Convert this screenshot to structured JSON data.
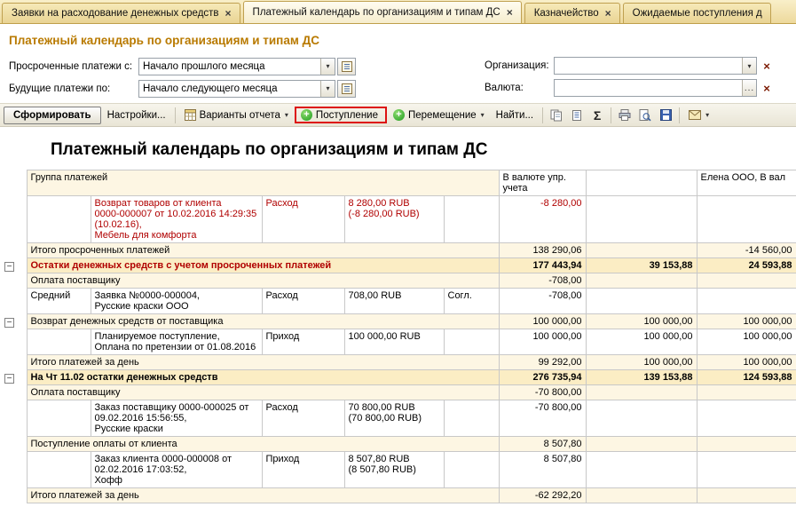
{
  "icons": {
    "close": "×",
    "dropdown": "▾",
    "clear": "×",
    "ellipsis": "...",
    "plus": "+",
    "sum": "Σ",
    "minus": "−"
  },
  "tabs": [
    {
      "label": "Заявки на расходование денежных средств",
      "active": false
    },
    {
      "label": "Платежный календарь по организациям и типам ДС",
      "active": true
    },
    {
      "label": "Казначейство",
      "active": false
    },
    {
      "label": "Ожидаемые поступления д",
      "active": false
    }
  ],
  "page_title": "Платежный календарь по организациям и типам ДС",
  "filters": {
    "overdue_label": "Просроченные платежи с:",
    "overdue_value": "Начало прошлого месяца",
    "future_label": "Будущие платежи по:",
    "future_value": "Начало следующего месяца",
    "organization_label": "Организация:",
    "organization_value": "",
    "currency_label": "Валюта:",
    "currency_value": ""
  },
  "toolbar": {
    "generate": "Сформировать",
    "settings": "Настройки...",
    "variants": "Варианты отчета",
    "receipt": "Поступление",
    "transfer": "Перемещение",
    "find": "Найти..."
  },
  "report": {
    "title": "Платежный календарь по организациям и типам ДС",
    "header": {
      "group": "Группа платежей",
      "mgmt_currency": "В валюте упр. учета",
      "col_mid": "",
      "org": "Елена ООО, В вал"
    },
    "rows": [
      {
        "b": "Возврат товаров от клиента\n0000-000007 от 10.02.2016 14:29:35\n(10.02.16),\nМебель для комфорта",
        "c": "Расход",
        "d": "8 280,00 RUB\n(-8 280,00 RUB)",
        "f": "-8 280,00"
      },
      {
        "a": "Итого просроченных платежей",
        "f": "138 290,06",
        "h": "-14 560,00"
      },
      {
        "a": "Остатки денежных средств с учетом просроченных платежей",
        "f": "177 443,94",
        "g": "39 153,88",
        "h": "24 593,88"
      },
      {
        "a": "Оплата поставщику",
        "f": "-708,00"
      },
      {
        "a": "Средний",
        "b": "Заявка №0000-000004,\nРусские краски ООО",
        "c": "Расход",
        "d": "708,00 RUB",
        "e": "Согл.",
        "f": "-708,00"
      },
      {
        "a": "Возврат денежных средств от поставщика",
        "f": "100 000,00",
        "g": "100 000,00",
        "h": "100 000,00"
      },
      {
        "b": "Планируемое поступление,\nОплана по претензии от 01.08.2016",
        "c": "Приход",
        "d": "100 000,00 RUB",
        "f": "100 000,00",
        "g": "100 000,00",
        "h": "100 000,00"
      },
      {
        "a": "Итого платежей за день",
        "f": "99 292,00",
        "g": "100 000,00",
        "h": "100 000,00"
      },
      {
        "a": "На Чт 11.02 остатки денежных средств",
        "f": "276 735,94",
        "g": "139 153,88",
        "h": "124 593,88"
      },
      {
        "a": "Оплата поставщику",
        "f": "-70 800,00"
      },
      {
        "b": "Заказ поставщику 0000-000025 от\n09.02.2016 15:56:55,\nРусские краски",
        "c": "Расход",
        "d": "70 800,00 RUB\n(70 800,00 RUB)",
        "f": "-70 800,00"
      },
      {
        "a": "Поступление оплаты от клиента",
        "f": "8 507,80"
      },
      {
        "b": "Заказ клиента 0000-000008 от\n02.02.2016 17:03:52,\nХофф",
        "c": "Приход",
        "d": "8 507,80 RUB\n(8 507,80 RUB)",
        "f": "8 507,80"
      },
      {
        "a": "Итого платежей за день",
        "f": "-62 292,20"
      }
    ]
  }
}
